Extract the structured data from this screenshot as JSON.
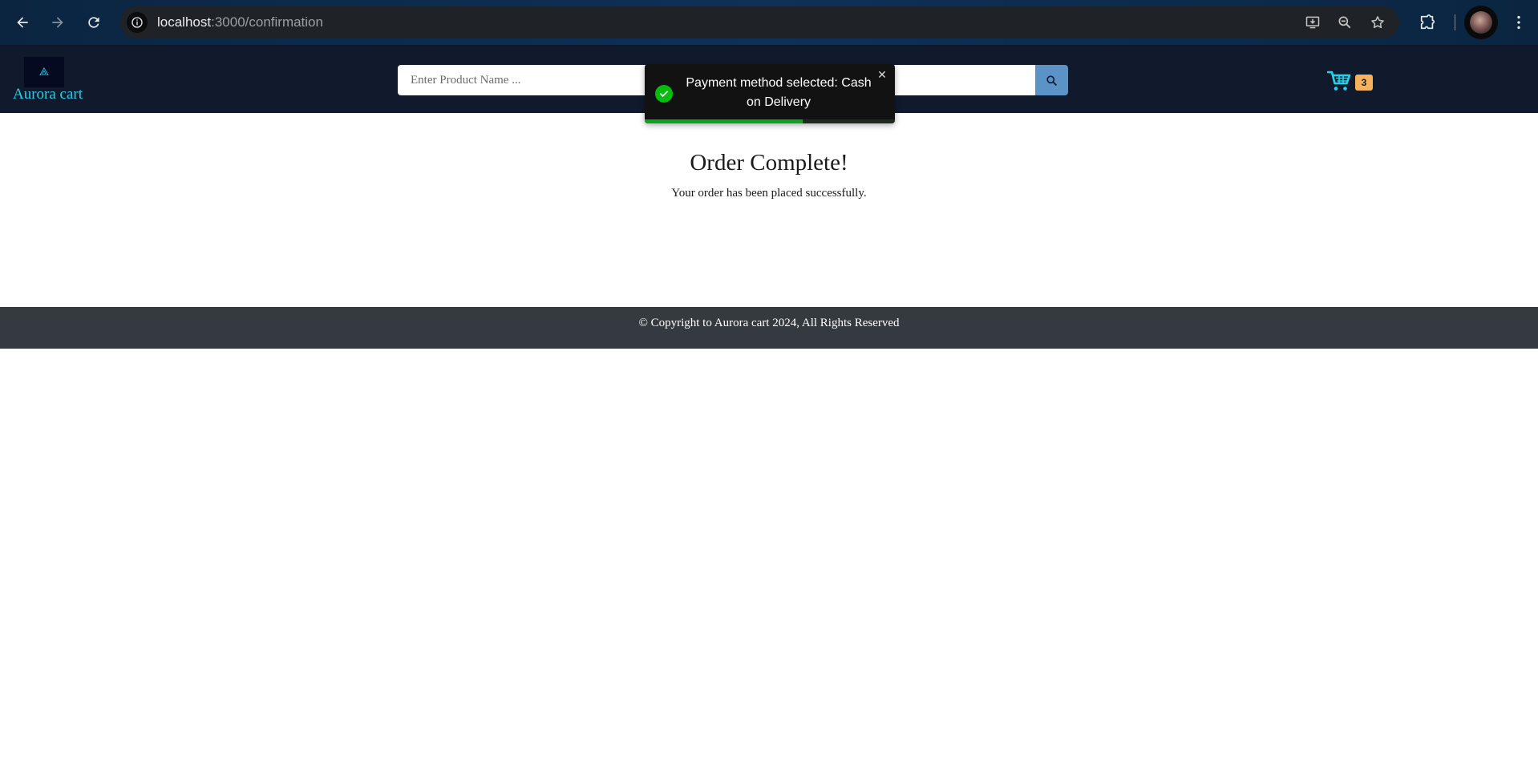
{
  "browser": {
    "url_host": "localhost",
    "url_path": ":3000/confirmation",
    "icons": [
      "back-arrow-icon",
      "forward-arrow-icon",
      "reload-icon",
      "site-info-icon",
      "install-app-icon",
      "zoom-icon",
      "bookmark-star-icon",
      "extensions-icon",
      "profile-avatar",
      "browser-menu-icon"
    ]
  },
  "header": {
    "logo_symbol": "⟁",
    "brand": "Aurora cart",
    "search_placeholder": "Enter Product Name ...",
    "cart_count": "3",
    "colors": {
      "background": "#101a2c",
      "brand": "#22d3ee",
      "search_button": "#5b93c7",
      "badge": "#f5b25c"
    }
  },
  "toast": {
    "message": "Payment method selected: Cash on Delivery",
    "close_symbol": "✕",
    "progress_fraction": 0.63,
    "type": "success"
  },
  "main": {
    "title": "Order Complete!",
    "subtitle": "Your order has been placed successfully."
  },
  "footer": {
    "text": "© Copyright to Aurora cart 2024, All Rights Reserved"
  }
}
